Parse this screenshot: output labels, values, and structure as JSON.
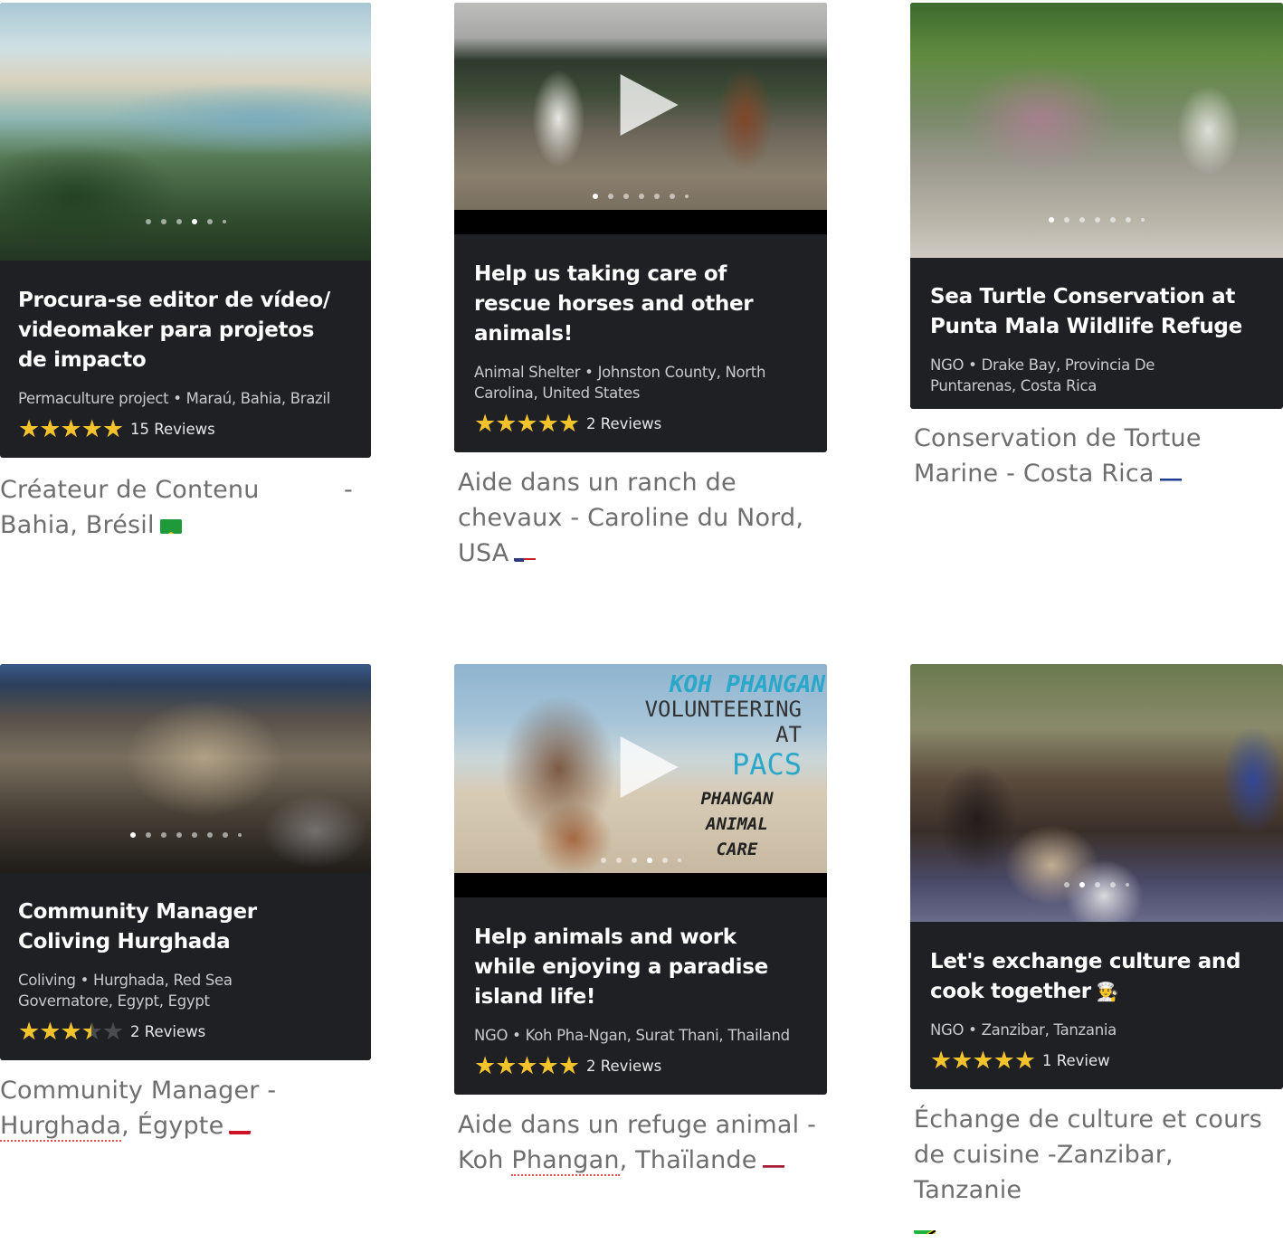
{
  "cards": [
    {
      "title": "Procura-se editor de vídeo/ videomaker para projetos de impacto",
      "category": "Permaculture project",
      "location": "Maraú, Bahia, Brazil",
      "rating": 5,
      "reviews": "15 Reviews",
      "caption_line1": "Créateur de Contenu",
      "caption_dash": "-",
      "caption_line2": "Bahia, Brésil",
      "flag": "brazil-flag-icon",
      "dots_total": 6,
      "dots_active": 4
    },
    {
      "title": "Help us taking care of rescue horses and other animals!",
      "category": "Animal Shelter",
      "location": "Johnston County, North Carolina, United States",
      "rating": 5,
      "reviews": "2 Reviews",
      "caption": "Aide dans un ranch de chevaux - Caroline du Nord, USA",
      "flag": "usa-flag-icon",
      "has_video": true
    },
    {
      "title": "Sea Turtle Conservation at Punta Mala Wildlife Refuge",
      "category": "NGO",
      "location": "Drake Bay, Provincia De Puntarenas, Costa Rica",
      "caption": "Conservation de Tortue Marine - Costa Rica",
      "flag": "costa-rica-flag-icon"
    },
    {
      "title": "Community Manager Coliving Hurghada",
      "category": "Coliving",
      "location": "Hurghada, Red Sea Governatore, Egypt, Egypt",
      "rating": 3.5,
      "reviews": "2 Reviews",
      "caption_pre": "Community Manager -",
      "caption_spell": "Hurghada",
      "caption_post": ", Égypte",
      "flag": "egypt-flag-icon"
    },
    {
      "title": "Help animals and work while enjoying a paradise island life!",
      "category": "NGO",
      "location": "Koh Pha-Ngan, Surat Thani, Thailand",
      "rating": 5,
      "reviews": "2 Reviews",
      "caption_pre": "Aide dans un refuge animal -",
      "caption_word": "Koh",
      "caption_spell": "Phangan",
      "caption_post": ", Thaïlande",
      "flag": "thailand-flag-icon",
      "has_video": true,
      "thumb_text": {
        "line1": "KOH PHANGAN",
        "line2": "VOLUNTEERING AT",
        "line3": "PACS",
        "line4": "PHANGAN",
        "line5": "ANIMAL",
        "line6": "CARE"
      }
    },
    {
      "title": "Let's exchange culture and cook together",
      "title_icon": "👨‍🍳",
      "category": "NGO",
      "location": "Zanzibar, Tanzania",
      "rating": 5,
      "reviews": "1 Review",
      "caption": "Échange de culture et cours de cuisine -Zanzibar, Tanzanie",
      "flag": "tanzania-flag-icon"
    }
  ],
  "separator": "•",
  "colors": {
    "card_bg": "#1f2024",
    "star": "#f4c22b",
    "caption": "#6e6e6e"
  }
}
